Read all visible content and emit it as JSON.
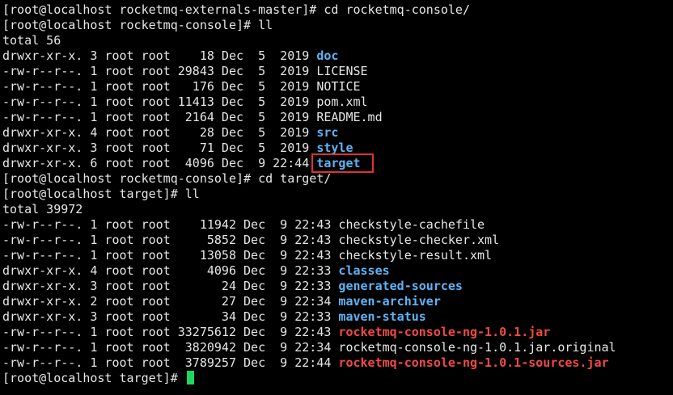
{
  "terminal": {
    "cursor_color": "#1ed760",
    "colors": {
      "text": "#e6e6e6",
      "directory": "#5fb3f5",
      "archive": "#ef4a46",
      "highlight_box": "#e0322f"
    },
    "lines": [
      {
        "kind": "cmd",
        "prefix": "[root@localhost rocketmq-externals-master]# ",
        "text": "cd rocketmq-console/"
      },
      {
        "kind": "cmd",
        "prefix": "[root@localhost rocketmq-console]# ",
        "text": "ll"
      },
      {
        "kind": "text",
        "text": "total 56"
      },
      {
        "kind": "entry",
        "prefix": "drwxr-xr-x. 3 root root    18 Dec  5  2019 ",
        "name": "doc",
        "type": "dir"
      },
      {
        "kind": "entry",
        "prefix": "-rw-r--r--. 1 root root 29843 Dec  5  2019 ",
        "name": "LICENSE",
        "type": "file"
      },
      {
        "kind": "entry",
        "prefix": "-rw-r--r--. 1 root root   176 Dec  5  2019 ",
        "name": "NOTICE",
        "type": "file"
      },
      {
        "kind": "entry",
        "prefix": "-rw-r--r--. 1 root root 11413 Dec  5  2019 ",
        "name": "pom.xml",
        "type": "file"
      },
      {
        "kind": "entry",
        "prefix": "-rw-r--r--. 1 root root  2164 Dec  5  2019 ",
        "name": "README.md",
        "type": "file"
      },
      {
        "kind": "entry",
        "prefix": "drwxr-xr-x. 4 root root    28 Dec  5  2019 ",
        "name": "src",
        "type": "dir"
      },
      {
        "kind": "entry",
        "prefix": "drwxr-xr-x. 3 root root    71 Dec  5  2019 ",
        "name": "style",
        "type": "dir"
      },
      {
        "kind": "entry",
        "prefix": "drwxr-xr-x. 6 root root  4096 Dec  9 22:44 ",
        "name": "target",
        "type": "dir",
        "highlighted": true
      },
      {
        "kind": "cmd",
        "prefix": "[root@localhost rocketmq-console]# ",
        "text": "cd target/"
      },
      {
        "kind": "cmd",
        "prefix": "[root@localhost target]# ",
        "text": "ll"
      },
      {
        "kind": "text",
        "text": "total 39972"
      },
      {
        "kind": "entry",
        "prefix": "-rw-r--r--. 1 root root    11942 Dec  9 22:43 ",
        "name": "checkstyle-cachefile",
        "type": "file"
      },
      {
        "kind": "entry",
        "prefix": "-rw-r--r--. 1 root root     5852 Dec  9 22:43 ",
        "name": "checkstyle-checker.xml",
        "type": "file"
      },
      {
        "kind": "entry",
        "prefix": "-rw-r--r--. 1 root root    13058 Dec  9 22:43 ",
        "name": "checkstyle-result.xml",
        "type": "file"
      },
      {
        "kind": "entry",
        "prefix": "drwxr-xr-x. 4 root root     4096 Dec  9 22:33 ",
        "name": "classes",
        "type": "dir"
      },
      {
        "kind": "entry",
        "prefix": "drwxr-xr-x. 3 root root       24 Dec  9 22:33 ",
        "name": "generated-sources",
        "type": "dir"
      },
      {
        "kind": "entry",
        "prefix": "drwxr-xr-x. 2 root root       27 Dec  9 22:34 ",
        "name": "maven-archiver",
        "type": "dir"
      },
      {
        "kind": "entry",
        "prefix": "drwxr-xr-x. 3 root root       34 Dec  9 22:33 ",
        "name": "maven-status",
        "type": "dir"
      },
      {
        "kind": "entry",
        "prefix": "-rw-r--r--. 1 root root 33275612 Dec  9 22:43 ",
        "name": "rocketmq-console-ng-1.0.1.jar",
        "type": "archive"
      },
      {
        "kind": "entry",
        "prefix": "-rw-r--r--. 1 root root  3820942 Dec  9 22:34 ",
        "name": "rocketmq-console-ng-1.0.1.jar.original",
        "type": "file"
      },
      {
        "kind": "entry",
        "prefix": "-rw-r--r--. 1 root root  3789257 Dec  9 22:44 ",
        "name": "rocketmq-console-ng-1.0.1-sources.jar",
        "type": "archive"
      },
      {
        "kind": "cmd",
        "prefix": "[root@localhost target]# ",
        "text": "",
        "cursor": true
      }
    ]
  }
}
